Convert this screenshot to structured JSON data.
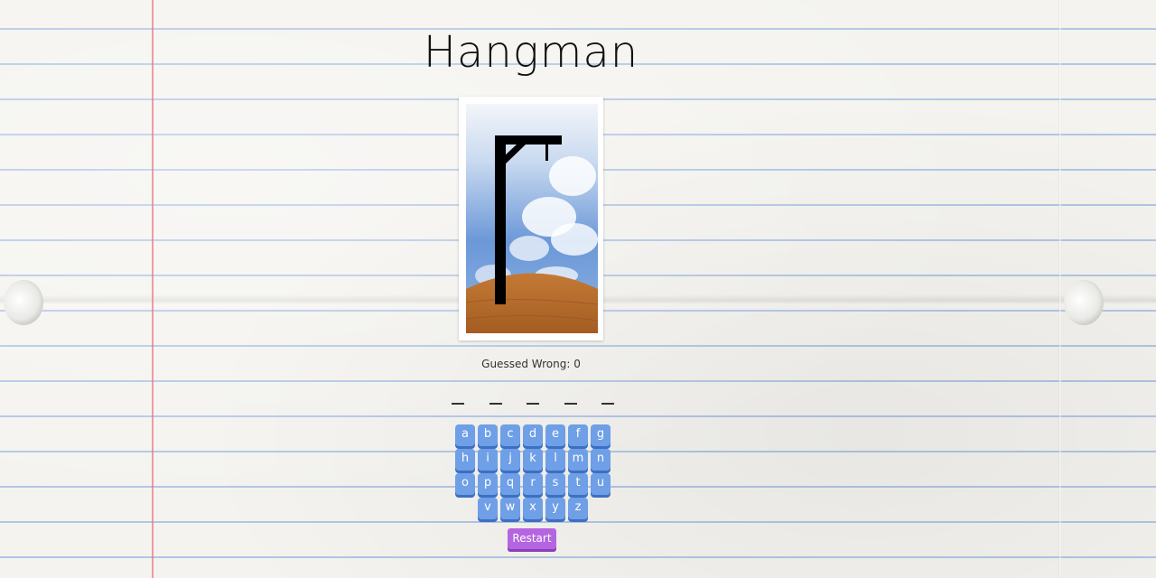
{
  "title": "Hangman",
  "status": {
    "guessed_wrong_label": "Guessed Wrong:",
    "guessed_wrong_count": "0"
  },
  "word": {
    "letters": [
      "_",
      "_",
      "_",
      "_",
      "_"
    ]
  },
  "keyboard": {
    "rows": [
      [
        "a",
        "b",
        "c",
        "d",
        "e",
        "f",
        "g"
      ],
      [
        "h",
        "i",
        "j",
        "k",
        "l",
        "m",
        "n"
      ],
      [
        "o",
        "p",
        "q",
        "r",
        "s",
        "t",
        "u"
      ],
      [
        "v",
        "w",
        "x",
        "y",
        "z"
      ]
    ]
  },
  "restart_label": "Restart",
  "colors": {
    "key": "#6f9fe6",
    "restart": "#b565e0",
    "sky": "#6b98d8",
    "ground": "#b86b2e",
    "gallows": "#000000"
  },
  "icons": {
    "hangman_image": "gallows-icon"
  }
}
